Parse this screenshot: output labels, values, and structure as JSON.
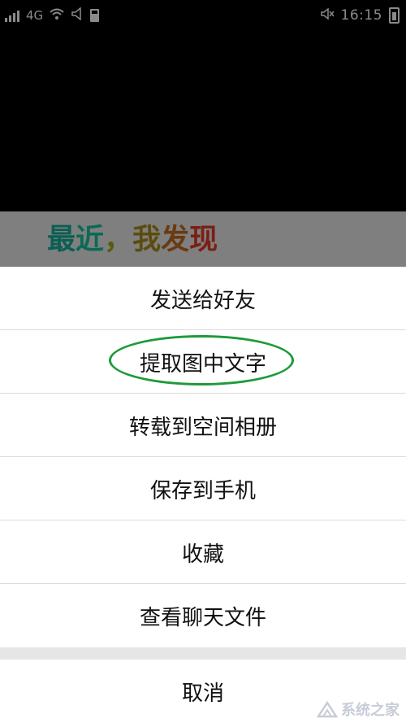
{
  "status_bar": {
    "network": "4G",
    "time": "16:15",
    "icons": [
      "signal-icon",
      "wifi-icon",
      "volume-icon",
      "sd-card-icon",
      "mute-icon",
      "battery-icon"
    ]
  },
  "preview": {
    "text_parts": [
      "最",
      "近",
      "，",
      "我",
      "发",
      "现"
    ]
  },
  "action_sheet": {
    "items": [
      {
        "label": "发送给好友"
      },
      {
        "label": "提取图中文字"
      },
      {
        "label": "转载到空间相册"
      },
      {
        "label": "保存到手机"
      },
      {
        "label": "收藏"
      },
      {
        "label": "查看聊天文件"
      }
    ],
    "cancel_label": "取消"
  },
  "watermark": {
    "text": "系统之家"
  },
  "colors": {
    "highlight_ring": "#1e9a3a",
    "sheet_background": "#ffffff",
    "backdrop": "#000000"
  }
}
